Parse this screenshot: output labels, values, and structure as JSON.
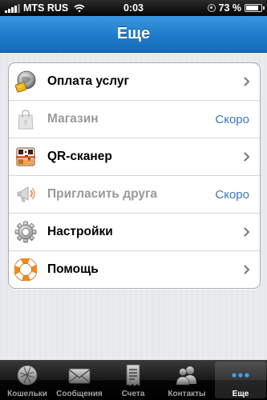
{
  "status_bar": {
    "carrier": "MTS RUS",
    "time": "0:03",
    "battery_percent": "73 %"
  },
  "navbar": {
    "title": "Еще"
  },
  "menu": {
    "items": [
      {
        "label": "Оплата услуг",
        "icon": "payment-coin-icon",
        "status": "",
        "enabled": true
      },
      {
        "label": "Магазин",
        "icon": "shopping-bag-icon",
        "status": "Скоро",
        "enabled": false
      },
      {
        "label": "QR-сканер",
        "icon": "qr-scanner-icon",
        "status": "",
        "enabled": true
      },
      {
        "label": "Пригласить друга",
        "icon": "megaphone-icon",
        "status": "Скоро",
        "enabled": false
      },
      {
        "label": "Настройки",
        "icon": "gear-icon",
        "status": "",
        "enabled": true
      },
      {
        "label": "Помощь",
        "icon": "lifebuoy-icon",
        "status": "",
        "enabled": true
      }
    ]
  },
  "tabbar": {
    "tabs": [
      {
        "label": "Кошельки",
        "icon": "wallet-globe-icon",
        "active": false
      },
      {
        "label": "Сообщения",
        "icon": "envelope-icon",
        "active": false
      },
      {
        "label": "Счета",
        "icon": "invoice-icon",
        "active": false
      },
      {
        "label": "Контакты",
        "icon": "contacts-icon",
        "active": false
      },
      {
        "label": "Еще",
        "icon": "more-dots-icon",
        "active": true
      }
    ]
  },
  "colors": {
    "navbar_blue": "#1f7dcc",
    "soon_text": "#3d76b8",
    "disabled_text": "#9a9a9a"
  }
}
